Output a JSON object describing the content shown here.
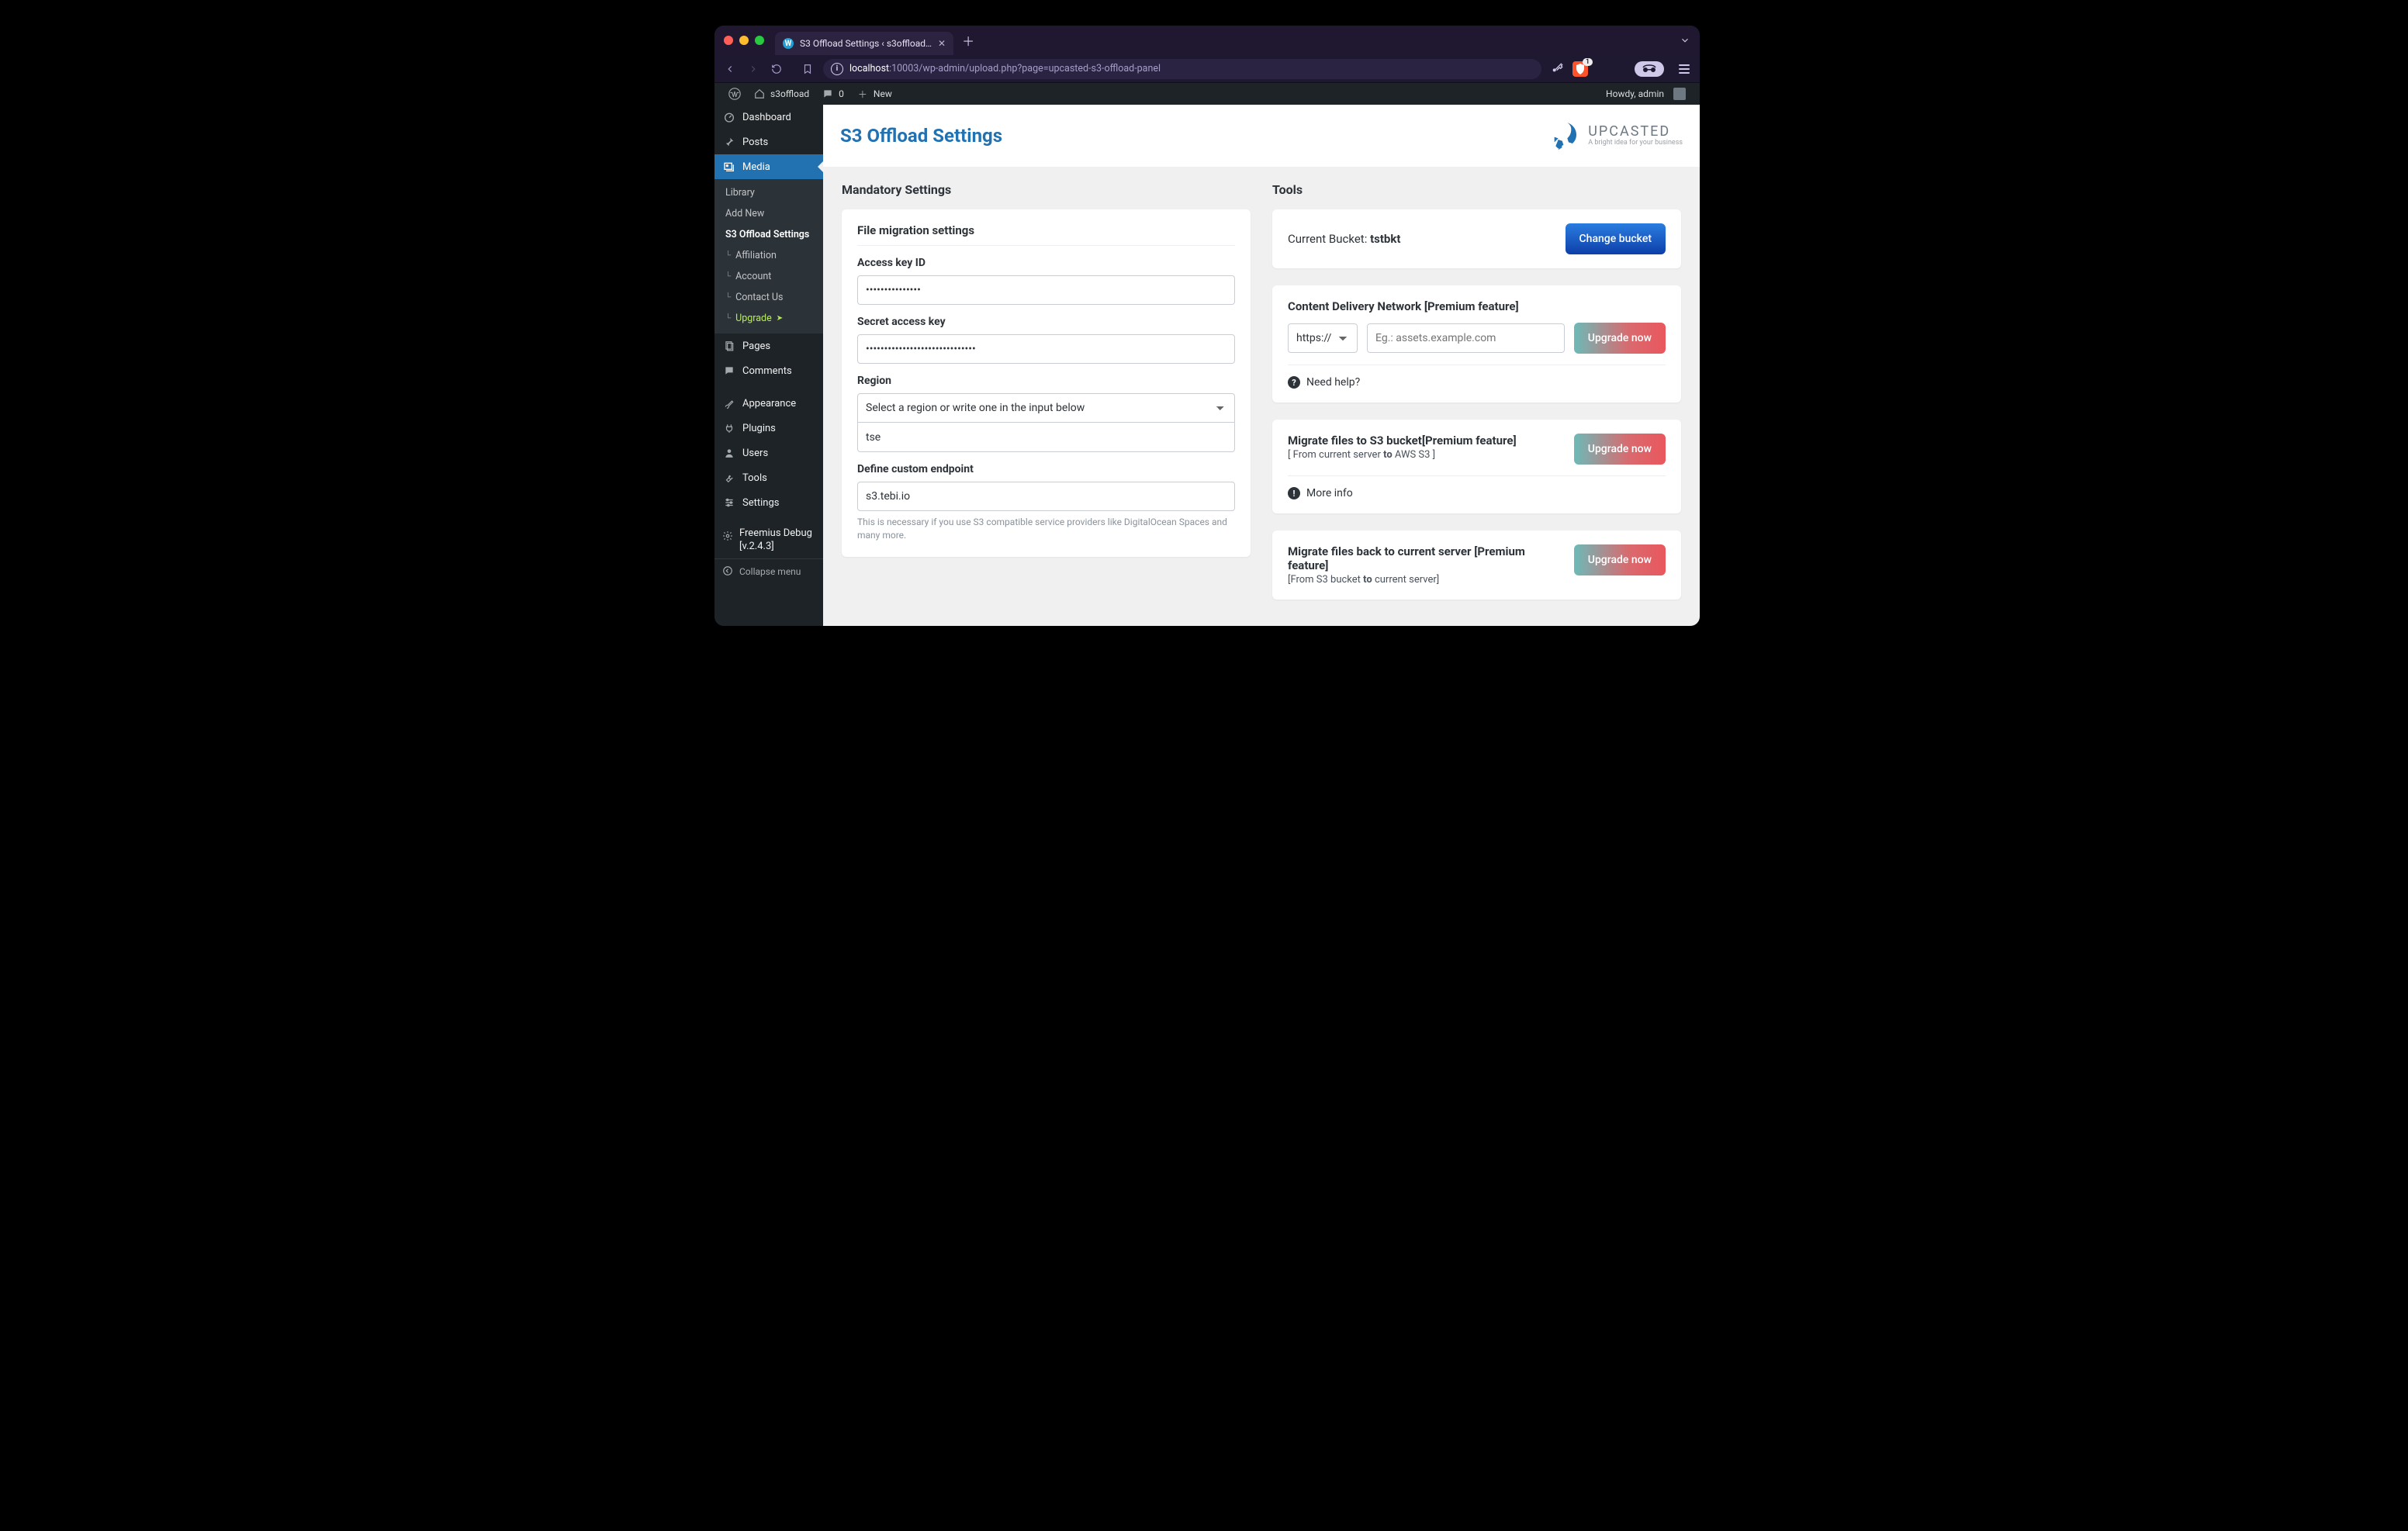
{
  "browser": {
    "tab_title": "S3 Offload Settings ‹ s3offload…",
    "url_host": "localhost",
    "url_port": ":10003",
    "url_path": "/wp-admin/upload.php?page=upcasted-s3-offload-panel"
  },
  "adminbar": {
    "site": "s3offload",
    "comments": "0",
    "new": "New",
    "howdy": "Howdy, admin"
  },
  "sidebar": {
    "dashboard": "Dashboard",
    "posts": "Posts",
    "media": "Media",
    "library": "Library",
    "add_new": "Add New",
    "s3_settings": "S3 Offload Settings",
    "affiliation": "Affiliation",
    "account": "Account",
    "contact": "Contact Us",
    "upgrade": "Upgrade",
    "pages": "Pages",
    "comments": "Comments",
    "appearance": "Appearance",
    "plugins": "Plugins",
    "users": "Users",
    "tools": "Tools",
    "settings": "Settings",
    "freemius": "Freemius Debug [v.2.4.3]",
    "collapse": "Collapse menu"
  },
  "page": {
    "title": "S3 Offload Settings",
    "brand_name": "UPCASTED",
    "brand_sub": "A bright idea for your business",
    "mandatory_heading": "Mandatory Settings",
    "tools_heading": "Tools"
  },
  "form": {
    "card_title": "File migration settings",
    "access_key_label": "Access key ID",
    "access_key_value": "•••••••••••••••",
    "secret_label": "Secret access key",
    "secret_value": "••••••••••••••••••••••••••••••",
    "region_label": "Region",
    "region_placeholder": "Select a region or write one in the input below",
    "region_custom_value": "tse",
    "endpoint_label": "Define custom endpoint",
    "endpoint_value": "s3.tebi.io",
    "endpoint_help": "This is necessary if you use S3 compatible service providers like DigitalOcean Spaces and many more."
  },
  "tools": {
    "bucket_label": "Current Bucket: ",
    "bucket_name": "tstbkt",
    "change_bucket": "Change bucket",
    "cdn_title": "Content Delivery Network [Premium feature]",
    "cdn_proto": "https://",
    "cdn_placeholder": "Eg.: assets.example.com",
    "upgrade_now": "Upgrade now",
    "need_help": "Need help?",
    "mig1_title": "Migrate files to S3 bucket[Premium feature]",
    "mig1_sub_pre": "[ From current server ",
    "mig1_sub_bold": "to",
    "mig1_sub_post": " AWS S3 ]",
    "more_info": "More info",
    "mig2_title": "Migrate files back to current server [Premium feature]",
    "mig2_sub_pre": "[From S3 bucket ",
    "mig2_sub_bold": "to",
    "mig2_sub_post": " current server]"
  }
}
